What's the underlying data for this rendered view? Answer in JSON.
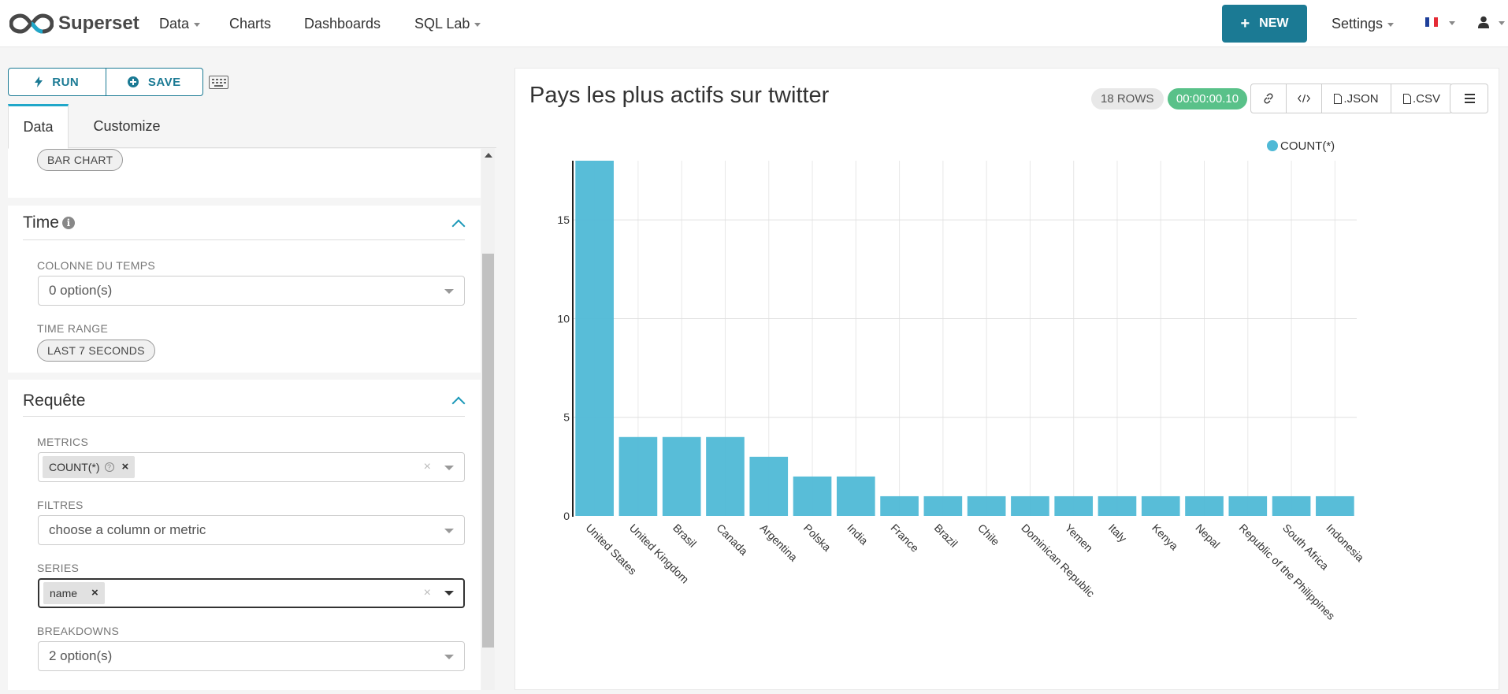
{
  "navbar": {
    "brand": "Superset",
    "menu": [
      {
        "label": "Data",
        "dropdown": true
      },
      {
        "label": "Charts",
        "dropdown": false
      },
      {
        "label": "Dashboards",
        "dropdown": false
      },
      {
        "label": "SQL Lab",
        "dropdown": true
      }
    ],
    "new_button": "NEW",
    "settings": "Settings",
    "language_icon": "french-flag-icon",
    "user_icon": "user-icon"
  },
  "toolbar": {
    "run_label": "RUN",
    "save_label": "SAVE"
  },
  "tabs": [
    "Data",
    "Customize"
  ],
  "viz_type": "BAR CHART",
  "time_section": {
    "title": "Time",
    "time_column_label": "COLONNE DU TEMPS",
    "time_column_value": "0 option(s)",
    "time_range_label": "TIME RANGE",
    "time_range_value": "LAST 7 SECONDS"
  },
  "query_section": {
    "title": "Requête",
    "metrics_label": "METRICS",
    "metric_tag": "COUNT(*)",
    "filters_label": "FILTRES",
    "filters_placeholder": "choose a column or metric",
    "series_label": "SERIES",
    "series_tag": "name",
    "breakdowns_label": "BREAKDOWNS",
    "breakdowns_value": "2 option(s)"
  },
  "chart_header": {
    "title": "Pays les plus actifs sur twitter",
    "rows_badge": "18 ROWS",
    "time_badge": "00:00:00.10",
    "json_label": ".JSON",
    "csv_label": ".CSV"
  },
  "chart_data": {
    "type": "bar",
    "title": "Pays les plus actifs sur twitter",
    "xlabel": "",
    "ylabel": "",
    "legend_position": "top-right",
    "ylim": [
      0,
      18
    ],
    "yticks": [
      0,
      5,
      10,
      15
    ],
    "grid": true,
    "color": "#4fb9d6",
    "series": [
      {
        "name": "COUNT(*)",
        "values": [
          18,
          4,
          4,
          4,
          3,
          2,
          2,
          1,
          1,
          1,
          1,
          1,
          1,
          1,
          1,
          1,
          1,
          1
        ]
      }
    ],
    "categories": [
      "United States",
      "United Kingdom",
      "Brasil",
      "Canada",
      "Argentina",
      "Polska",
      "India",
      "France",
      "Brazil",
      "Chile",
      "Dominican Republic",
      "Yemen",
      "Italy",
      "Kenya",
      "Nepal",
      "Republic of the Philippines",
      "South Africa",
      "Indonesia"
    ]
  }
}
